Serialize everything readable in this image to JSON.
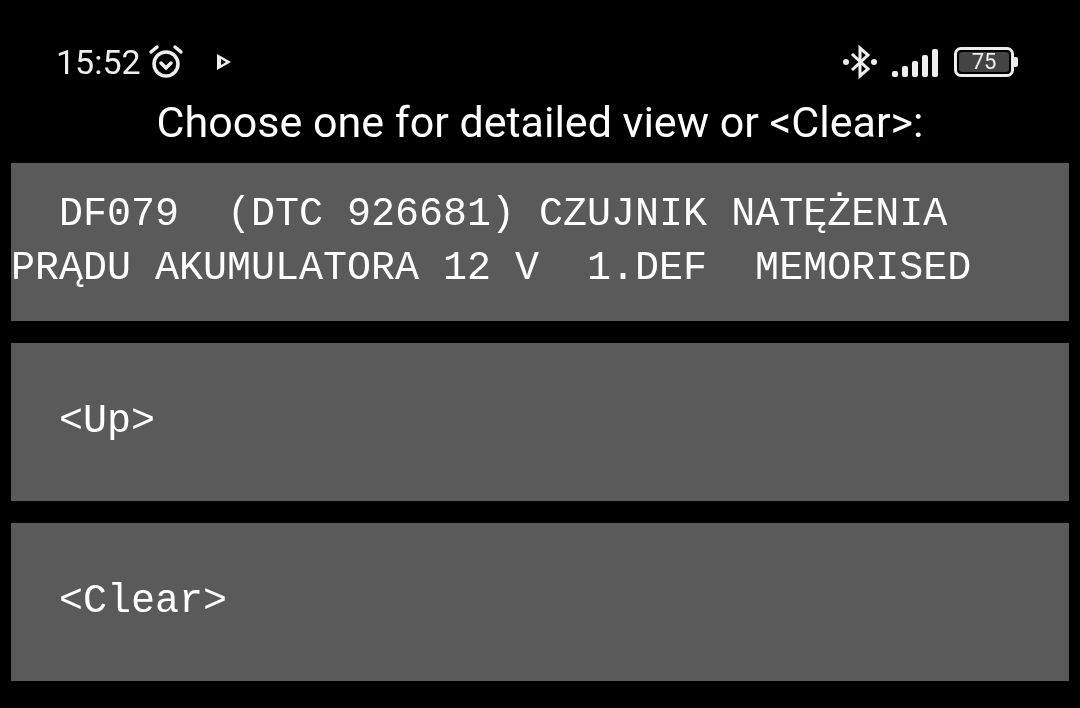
{
  "status_bar": {
    "time": "15:52",
    "battery": "75"
  },
  "prompt": "Choose one for detailed view or <Clear>:",
  "options": [
    {
      "label": "  DF079  (DTC 926681) CZUJNIK NATĘŻENIA PRĄDU AKUMULATORA 12 V  1.DEF  MEMORISED"
    },
    {
      "label": "  <Up>"
    },
    {
      "label": "  <Clear>"
    }
  ]
}
